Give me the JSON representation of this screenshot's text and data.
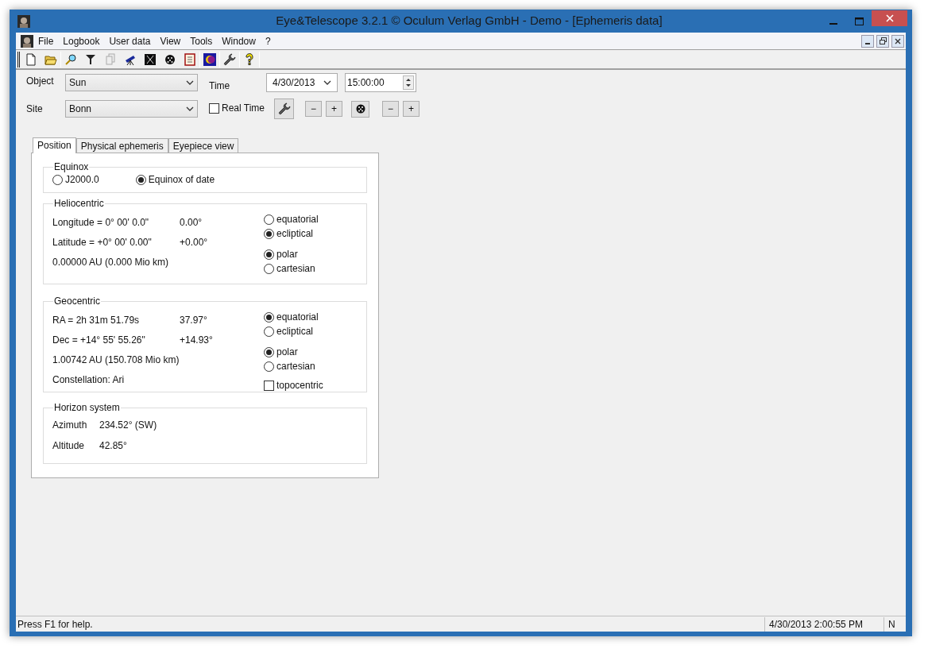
{
  "window": {
    "title": "Eye&Telescope 3.2.1 © Oculum Verlag GmbH - Demo - [Ephemeris data]"
  },
  "menu": {
    "items": [
      "File",
      "Logbook",
      "User data",
      "View",
      "Tools",
      "Window",
      "?"
    ]
  },
  "controls": {
    "object": {
      "label": "Object",
      "value": "Sun"
    },
    "site": {
      "label": "Site",
      "value": "Bonn"
    },
    "time": {
      "label": "Time",
      "date": "4/30/2013",
      "clock": "15:00:00"
    },
    "real_time": {
      "label": "Real Time",
      "checked": false
    },
    "time_steps": [
      "−",
      "+"
    ],
    "zoom_steps": [
      "−",
      "+"
    ]
  },
  "tabs": [
    {
      "label": "Position",
      "selected": true
    },
    {
      "label": "Physical ephemeris",
      "selected": false
    },
    {
      "label": "Eyepiece view",
      "selected": false
    }
  ],
  "equinox": {
    "title": "Equinox",
    "options": [
      {
        "label": "J2000.0",
        "selected": false
      },
      {
        "label": "Equinox of date",
        "selected": true
      }
    ]
  },
  "heliocentric": {
    "title": "Heliocentric",
    "rows": [
      {
        "text": "Longitude = 0° 00' 0.0\"",
        "degrees": "0.00°"
      },
      {
        "text": "Latitude = +0° 00' 0.00\"",
        "degrees": "+0.00°"
      }
    ],
    "lines": [
      "0.00000 AU (0.000 Mio km)"
    ],
    "frame_options": [
      {
        "label": "equatorial",
        "selected": false
      },
      {
        "label": "ecliptical",
        "selected": true
      }
    ],
    "form_options": [
      {
        "label": "polar",
        "selected": true
      },
      {
        "label": "cartesian",
        "selected": false
      }
    ]
  },
  "geocentric": {
    "title": "Geocentric",
    "rows": [
      {
        "text": "RA = 2h 31m 51.79s",
        "degrees": "37.97°"
      },
      {
        "text": "Dec = +14° 55' 55.26\"",
        "degrees": "+14.93°"
      }
    ],
    "lines": [
      "1.00742 AU (150.708 Mio km)",
      "Constellation: Ari"
    ],
    "frame_options": [
      {
        "label": "equatorial",
        "selected": true
      },
      {
        "label": "ecliptical",
        "selected": false
      }
    ],
    "form_options": [
      {
        "label": "polar",
        "selected": true
      },
      {
        "label": "cartesian",
        "selected": false
      }
    ],
    "topocentric": {
      "label": "topocentric",
      "checked": false
    }
  },
  "horizon": {
    "title": "Horizon system",
    "rows": [
      {
        "label": "Azimuth",
        "value": "234.52° (SW)"
      },
      {
        "label": "Altitude",
        "value": "42.85°"
      }
    ]
  },
  "status_bar": {
    "help": "Press F1 for help.",
    "datetime": "4/30/2013 2:00:55 PM",
    "column_3": "N"
  }
}
